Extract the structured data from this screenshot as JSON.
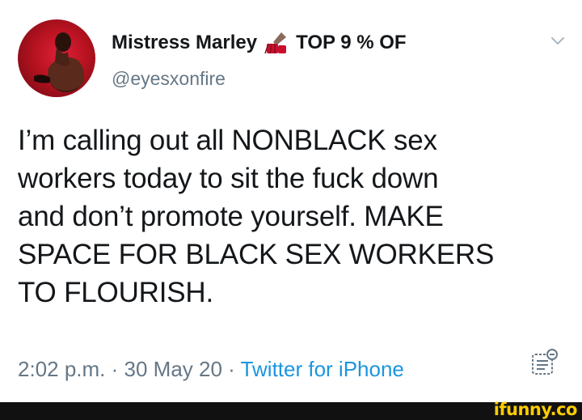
{
  "tweet": {
    "display_name": "Mistress Marley",
    "badge_emoji": "nail-polish-emoji",
    "badge_text": "TOP 9 % OF",
    "handle": "@eyesxonfire",
    "text_lines": [
      "I’m calling out all NONBLACK sex",
      "workers today to sit the fuck down",
      "and don’t promote yourself. MAKE",
      "SPACE FOR BLACK SEX WORKERS",
      "TO FLOURISH."
    ],
    "time": "2:02 p.m.",
    "separator": " · ",
    "date": "30 May 20",
    "source": "Twitter for iPhone"
  },
  "footer": {
    "watermark": "ifunny.co"
  },
  "colors": {
    "text": "#14171a",
    "secondary": "#657786",
    "link": "#1b95e0",
    "watermark": "#ffcc00"
  }
}
